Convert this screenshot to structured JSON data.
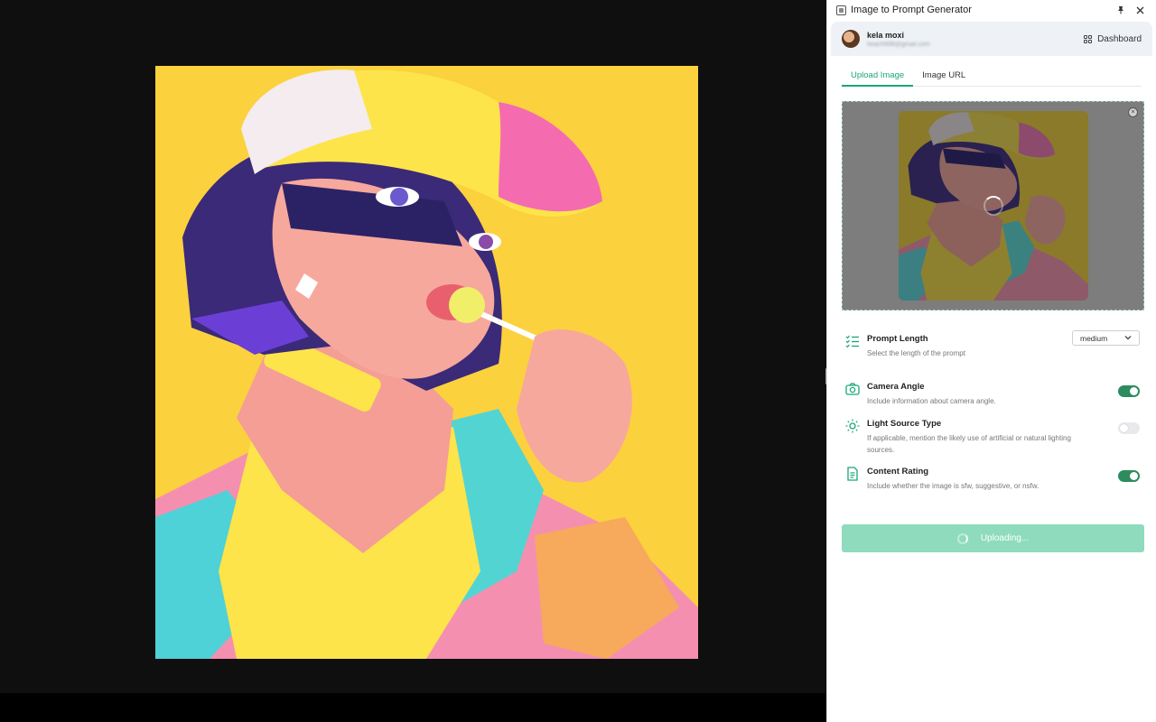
{
  "window": {
    "title": "Image to Prompt Generator"
  },
  "user": {
    "name": "kela moxi",
    "email": "heach698@gmail.com"
  },
  "header": {
    "dashboard_label": "Dashboard"
  },
  "tabs": [
    {
      "label": "Upload Image",
      "active": true
    },
    {
      "label": "Image URL",
      "active": false
    }
  ],
  "settings": {
    "prompt_length": {
      "title": "Prompt Length",
      "desc": "Select the length of the prompt",
      "value": "medium"
    },
    "camera_angle": {
      "title": "Camera Angle",
      "desc": "Include information about camera angle.",
      "enabled": true
    },
    "light_source": {
      "title": "Light Source Type",
      "desc": "If applicable, mention the likely use of artificial or natural lighting sources.",
      "enabled": false
    },
    "content_rating": {
      "title": "Content Rating",
      "desc": "Include whether the image is sfw, suggestive, or nsfw.",
      "enabled": true
    }
  },
  "upload_button": {
    "label": "Uploading..."
  },
  "colors": {
    "accent": "#1aa67a",
    "toggle_on": "#2d8c5e",
    "button_disabled": "#8edbbe",
    "art_background": "#fbd13e"
  },
  "icons": [
    "pin-icon",
    "close-icon",
    "grid-icon",
    "list-icon",
    "camera-icon",
    "sun-icon",
    "document-icon",
    "chevron-down-icon"
  ]
}
